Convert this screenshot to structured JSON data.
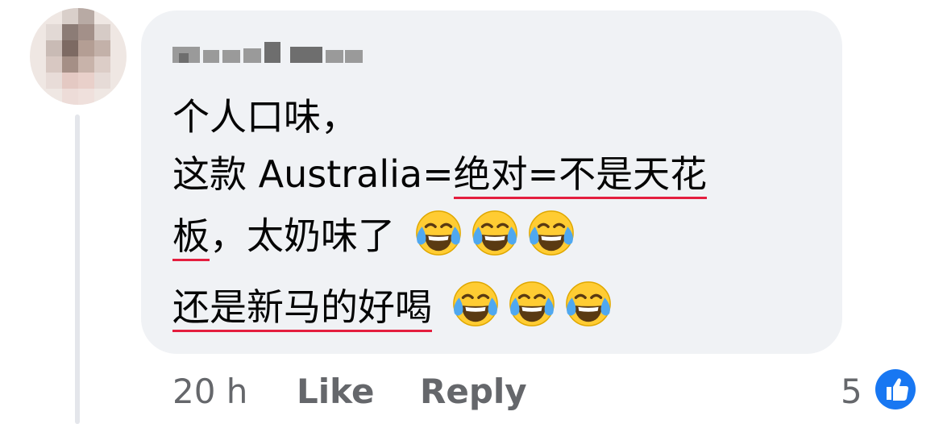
{
  "comment": {
    "author": "Carol Cao",
    "lines": {
      "l1": "个人口味，",
      "l2a": "这款 Australia=",
      "l2b": "绝对",
      "l2c": "=不是天花",
      "l3a": "板",
      "l3b": "，太奶味了 ",
      "l4": "还是新马的好喝"
    },
    "emoji": "face-with-tears-of-joy"
  },
  "actions": {
    "time": "20 h",
    "like": "Like",
    "reply": "Reply",
    "like_count": "5"
  },
  "colors": {
    "bubble": "#f0f2f5",
    "text": "#050505",
    "muted": "#65676b",
    "underline": "#e41e3f",
    "like_blue": "#1877f2"
  }
}
